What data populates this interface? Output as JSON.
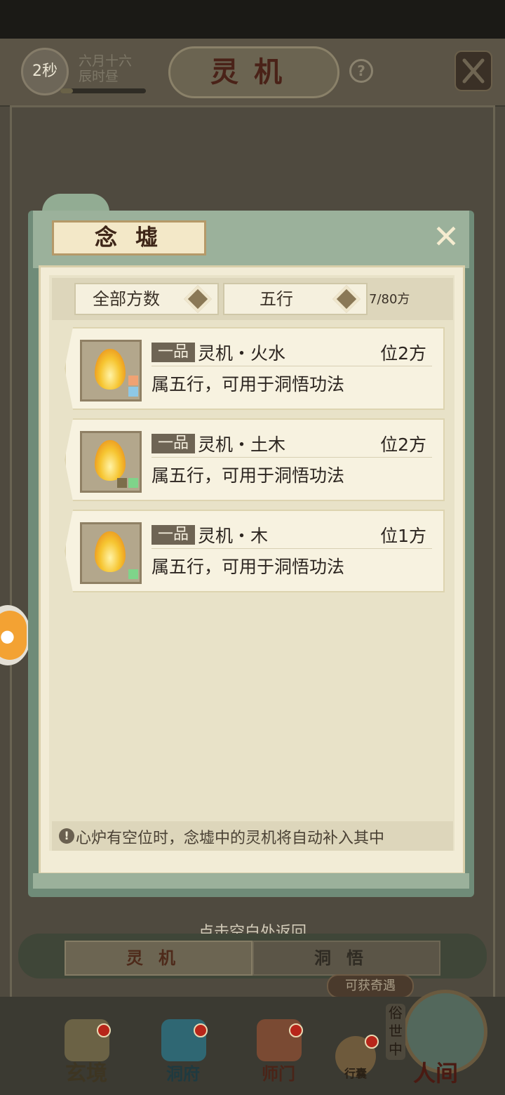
{
  "status": {
    "timer": "2秒",
    "date_line1": "六月十六",
    "date_line2": "辰时昼",
    "time_progress": 0.15
  },
  "screen_title": "灵机",
  "help_label": "?",
  "dialog": {
    "title": "念墟",
    "close_glyph": "✕",
    "filters": [
      {
        "label": "全部方数"
      },
      {
        "label": "五行"
      }
    ],
    "capacity": "7/80方",
    "items": [
      {
        "grade": "一品",
        "name": "灵机・火水",
        "count": "位2方",
        "desc": "属五行，可用于洞悟功法",
        "elements": [
          "#f0a273",
          "#8ec8e6"
        ]
      },
      {
        "grade": "一品",
        "name": "灵机・土木",
        "count": "位2方",
        "desc": "属五行，可用于洞悟功法",
        "elements": [
          "#7c6e4a",
          "#7fd48a"
        ]
      },
      {
        "grade": "一品",
        "name": "灵机・木",
        "count": "位1方",
        "desc": "属五行，可用于洞悟功法",
        "elements": [
          "#7fd48a"
        ]
      }
    ],
    "notice_icon": "!",
    "notice": "心炉有空位时，念墟中的灵机将自动补入其中"
  },
  "back_hint": "点击空白处返回",
  "tabs": [
    {
      "label": "灵机"
    },
    {
      "label": "洞悟"
    }
  ],
  "event_tag": "可获奇遇",
  "bottom_nav": [
    {
      "label": "玄境",
      "icon": "scroll-icon"
    },
    {
      "label": "洞府",
      "icon": "pavilion-icon"
    },
    {
      "label": "师门",
      "icon": "banner-icon"
    },
    {
      "label": "行囊",
      "icon": "bag-icon"
    },
    {
      "label": "人间",
      "icon": "landscape-icon"
    }
  ],
  "side_tag": "俗世中",
  "colors": {
    "dialog_green": "#9bb19b",
    "panel_cream": "#f2ecd6",
    "item_bg": "#f7f2e0",
    "grade_badge": "#6e6454",
    "notice_bg": "#ddd6bb"
  }
}
